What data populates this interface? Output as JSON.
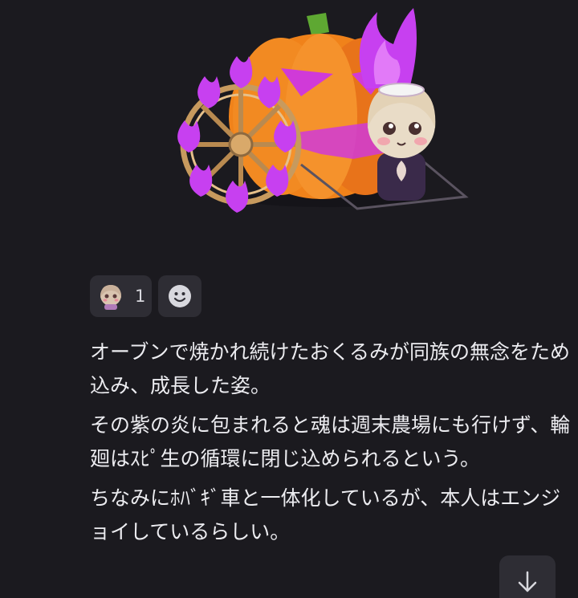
{
  "reactions": [
    {
      "emoji_name": "chibi-girl-emoji",
      "count": "1"
    },
    {
      "emoji_name": "add-reaction-smiley-icon"
    }
  ],
  "message": {
    "paragraphs": [
      "オーブンで焼かれ続けたおくるみが同族の無念をため込み、成長した姿。",
      "その紫の炎に包まれると魂は週末農場にも行けず、輪廻はｽﾋﾟ生の循環に閉じ込められるという。",
      "ちなみにﾎﾊﾞｷﾞ車と一体化しているが、本人はエンジョイしているらしい。"
    ]
  },
  "colors": {
    "background": "#1b1a1f",
    "chip": "#2e2d34",
    "text": "#ececf0",
    "pumpkin": "#f07c18",
    "flame": "#c53cf0"
  }
}
